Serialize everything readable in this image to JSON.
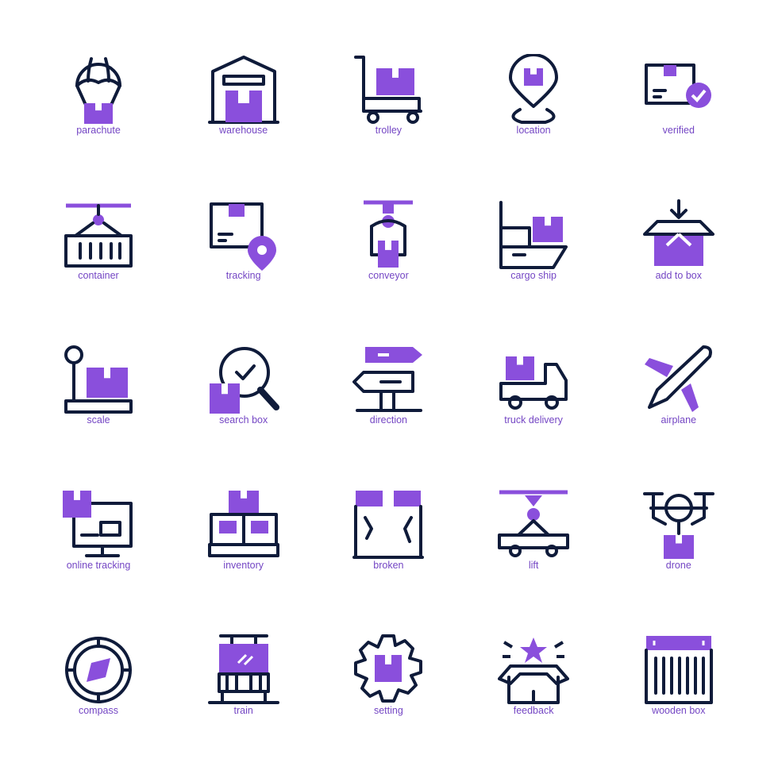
{
  "colors": {
    "primary": "#0f1b3a",
    "accent": "#8a4fdc",
    "label": "#7446c4",
    "background": "#ffffff"
  },
  "icons": [
    {
      "label": "parachute",
      "icon": "parachute-icon"
    },
    {
      "label": "warehouse",
      "icon": "warehouse-icon"
    },
    {
      "label": "trolley",
      "icon": "trolley-icon"
    },
    {
      "label": "location",
      "icon": "location-icon"
    },
    {
      "label": "verified",
      "icon": "verified-icon"
    },
    {
      "label": "container",
      "icon": "container-icon"
    },
    {
      "label": "tracking",
      "icon": "tracking-icon"
    },
    {
      "label": "conveyor",
      "icon": "conveyor-icon"
    },
    {
      "label": "cargo ship",
      "icon": "cargo-ship-icon"
    },
    {
      "label": "add to box",
      "icon": "add-to-box-icon"
    },
    {
      "label": "scale",
      "icon": "scale-icon"
    },
    {
      "label": "search box",
      "icon": "search-box-icon"
    },
    {
      "label": "direction",
      "icon": "direction-icon"
    },
    {
      "label": "truck delivery",
      "icon": "truck-delivery-icon"
    },
    {
      "label": "airplane",
      "icon": "airplane-icon"
    },
    {
      "label": "online tracking",
      "icon": "online-tracking-icon"
    },
    {
      "label": "inventory",
      "icon": "inventory-icon"
    },
    {
      "label": "broken",
      "icon": "broken-icon"
    },
    {
      "label": "lift",
      "icon": "lift-icon"
    },
    {
      "label": "drone",
      "icon": "drone-icon"
    },
    {
      "label": "compass",
      "icon": "compass-icon"
    },
    {
      "label": "train",
      "icon": "train-icon"
    },
    {
      "label": "setting",
      "icon": "setting-icon"
    },
    {
      "label": "feedback",
      "icon": "feedback-icon"
    },
    {
      "label": "wooden box",
      "icon": "wooden-box-icon"
    }
  ]
}
